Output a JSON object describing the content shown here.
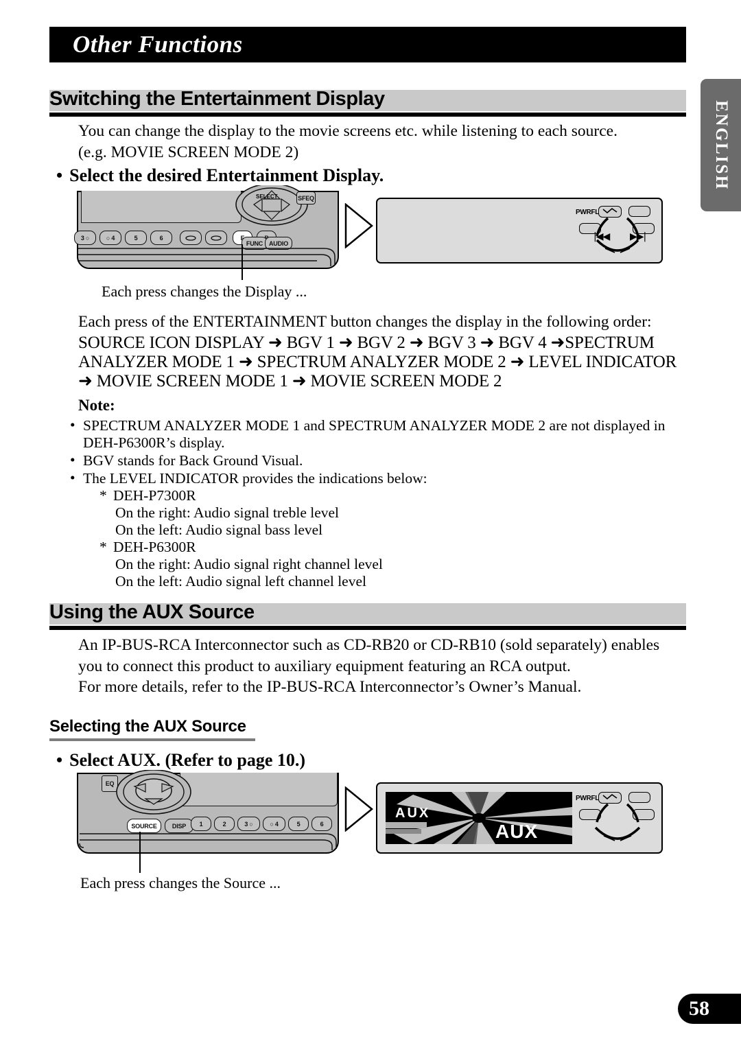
{
  "page": {
    "title": "Other Functions",
    "side_tab_label": "ENGLISH",
    "page_number": "58"
  },
  "section1": {
    "heading": "Switching the Entertainment Display",
    "intro_line1": "You can change the display to the movie screens etc. while listening to each source.",
    "intro_line2": "(e.g. MOVIE SCREEN MODE 2)",
    "bullet": "Select the desired Entertainment Display.",
    "caption": "Each press changes the Display ...",
    "order_intro": "Each press of the ENTERTAINMENT button changes the display in the following order:",
    "order_line1": "SOURCE ICON DISPLAY ➜ BGV 1 ➜ BGV 2 ➜ BGV 3 ➜ BGV 4 ➜SPECTRUM",
    "order_line2": "ANALYZER MODE 1 ➜ SPECTRUM ANALYZER MODE 2 ➜ LEVEL INDICATOR",
    "order_line3": "➜ MOVIE SCREEN MODE 1 ➜ MOVIE SCREEN MODE 2",
    "note_title": "Note:",
    "notes": [
      "SPECTRUM ANALYZER MODE 1 and SPECTRUM ANALYZER MODE 2 are not displayed in",
      "DEH-P6300R’s display.",
      "BGV stands for Back Ground Visual.",
      "The LEVEL INDICATOR provides the indications below:",
      "DEH-P7300R",
      "On the right: Audio signal treble level",
      "On the left:   Audio signal bass level",
      "DEH-P6300R",
      "On the right: Audio signal right channel level",
      "On the left:   Audio signal left channel level"
    ]
  },
  "section2": {
    "heading": "Using the AUX Source",
    "para1_line1": "An IP-BUS-RCA Interconnector such as CD-RB20 or CD-RB10 (sold separately) enables",
    "para1_line2": "you to connect this product to auxiliary equipment featuring an RCA output.",
    "para2": "For more details, refer to the IP-BUS-RCA Interconnector’s Owner’s Manual.",
    "subheading": "Selecting the AUX Source",
    "bullet": "Select AUX. (Refer to page 10.)",
    "caption": "Each press changes the Source ..."
  },
  "illustration_top": {
    "buttons": [
      "3 ○",
      "○ 4",
      "5",
      "6",
      "E",
      "B"
    ],
    "highlighted_button": "E",
    "control_labels": [
      "SELECT",
      "SFEQ",
      "FUNC",
      "AUDIO"
    ]
  },
  "illustration_bottom": {
    "buttons": [
      "1",
      "2",
      "3 ○",
      "○ 4",
      "5",
      "6"
    ],
    "control_labels": [
      "EQ",
      "SOURCE",
      "DISP"
    ],
    "highlighted_button": "SOURCE"
  },
  "display_top": {
    "power_label": "PWRFL"
  },
  "display_bottom": {
    "power_label": "PWRFL",
    "screen_text_small": "AUX",
    "screen_text_large": "AUX"
  },
  "colors": {
    "title_bar": "#000000",
    "heading_band": "#c9c9c9",
    "side_tab": "#6b6b6b",
    "device_body": "#b9b9b9",
    "display_bezel": "#dcdcdc"
  }
}
